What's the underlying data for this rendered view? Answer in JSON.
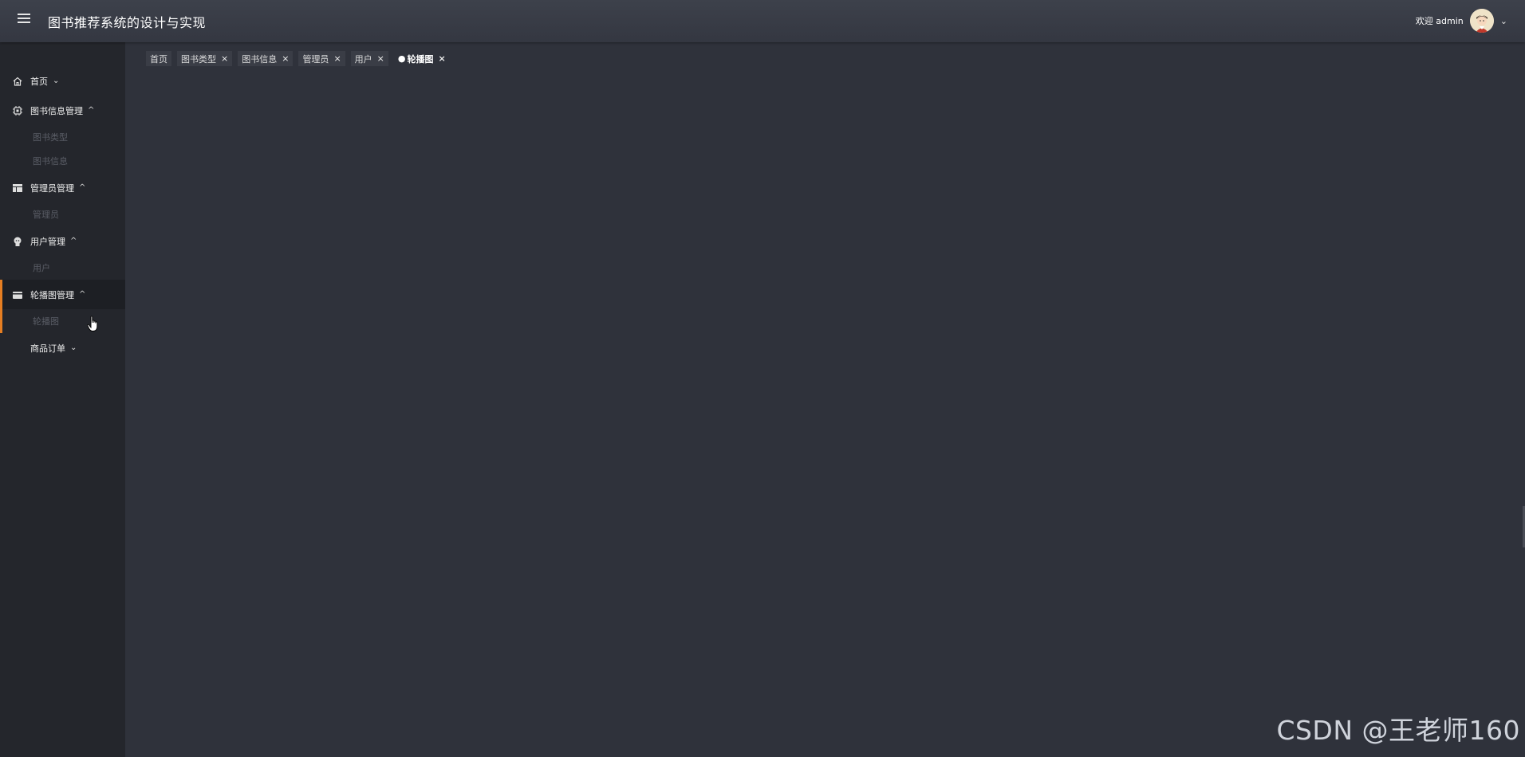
{
  "app": {
    "title": "图书推荐系统的设计与实现"
  },
  "user": {
    "welcome": "欢迎 admin"
  },
  "sidebar": {
    "items": [
      {
        "label": "首页",
        "icon": "home-icon",
        "expanded": false,
        "subitems": []
      },
      {
        "label": "图书信息管理",
        "icon": "chip-icon",
        "expanded": true,
        "subitems": [
          "图书类型",
          "图书信息"
        ]
      },
      {
        "label": "管理员管理",
        "icon": "layout-icon",
        "expanded": true,
        "subitems": [
          "管理员"
        ]
      },
      {
        "label": "用户管理",
        "icon": "user-icon",
        "expanded": true,
        "subitems": [
          "用户"
        ]
      },
      {
        "label": "轮播图管理",
        "icon": "card-icon",
        "expanded": true,
        "active": true,
        "subitems": [
          "轮播图"
        ]
      },
      {
        "label": "商品订单",
        "icon": "",
        "expanded": false,
        "subitems": []
      }
    ]
  },
  "tabs": [
    {
      "label": "首页",
      "closable": false
    },
    {
      "label": "图书类型",
      "closable": true
    },
    {
      "label": "图书信息",
      "closable": true
    },
    {
      "label": "管理员",
      "closable": true
    },
    {
      "label": "用户",
      "closable": true
    },
    {
      "label": "轮播图",
      "closable": true,
      "active": true
    }
  ],
  "watermark": "CSDN @王老师160",
  "colors": {
    "accent": "#e67e22",
    "sidebar_bg": "#24262c",
    "main_bg": "#2f323b",
    "topbar_bg": "#3a3d46"
  }
}
